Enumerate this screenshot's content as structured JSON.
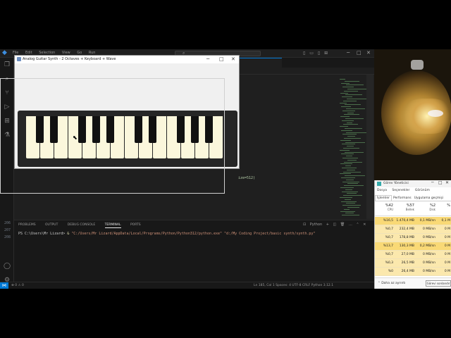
{
  "vscode": {
    "menu": [
      "File",
      "Edit",
      "Selection",
      "View",
      "Go",
      "Run"
    ],
    "search_placeholder": "Search",
    "code_fragment": "ize=512)",
    "line_numbers": [
      "206",
      "207",
      "208"
    ],
    "panel_tabs": [
      "PROBLEMS",
      "OUTPUT",
      "DEBUG CONSOLE",
      "TERMINAL",
      "PORTS"
    ],
    "panel_active_tab": "TERMINAL",
    "terminal_shell": "Python",
    "terminal": {
      "prompt": "PS C:\\Users\\Mr Lizard> ",
      "amp": "& ",
      "exe": "\"C:/Users/Mr Lizard/AppData/Local/Programs/Python/Python312/python.exe\"",
      "script": " \"d:/My Coding Project/basic synth/synth.py\""
    },
    "status_left": "⊗ 0 ⚠ 0",
    "status_right": "Ln 185, Col 1   Spaces: 4   UTF-8   CRLF   Python   3.12.1"
  },
  "synth": {
    "title": "Analog Guitar Synth - 2 Octaves + Keyboard + Wave",
    "white_key_count": 14,
    "black_key_after_white": [
      0,
      1,
      3,
      4,
      5,
      7,
      8,
      10,
      11,
      12
    ]
  },
  "taskman": {
    "title": "Görev Yöneticisi",
    "menu": [
      "Dosya",
      "Seçenekler",
      "Görünüm"
    ],
    "tabs": [
      "İşlemler",
      "Performans",
      "Uygulama geçmişi"
    ],
    "active_tab": "İşlemler",
    "headers": [
      {
        "pct": "%42",
        "label": "CPU"
      },
      {
        "pct": "%57",
        "label": "Bellek"
      },
      {
        "pct": "%2",
        "label": "Disk"
      },
      {
        "pct": "%",
        "label": ""
      }
    ],
    "rows": [
      [
        "%16,5",
        "1.470,4 MB",
        "0,1 MB/sn",
        "0,1 M"
      ],
      [
        "%0,7",
        "232,4 MB",
        "0 MB/sn",
        "0 M"
      ],
      [
        "%0,7",
        "178,8 MB",
        "0 MB/sn",
        "0 M"
      ],
      [
        "%13,7",
        "130,3 MB",
        "0,2 MB/sn",
        "0 M"
      ],
      [
        "%0,7",
        "27,0 MB",
        "0 MB/sn",
        "0 M"
      ],
      [
        "%0,3",
        "26,5 MB",
        "0 MB/sn",
        "0 M"
      ],
      [
        "%0",
        "26,4 MB",
        "0 MB/sn",
        "0 M"
      ]
    ],
    "row_colors": [
      "#f9d976",
      "#fbe8ad",
      "#fbe8ad",
      "#f9d976",
      "#fbe8ad",
      "#fbe8ad",
      "#fbe8ad"
    ],
    "less_details": "Daha az ayrıntı",
    "end_task": "Görevi sonlandır"
  },
  "colors": {
    "accent": "#0078d4",
    "white_key": "#fbf7dc",
    "black_key": "#111111"
  }
}
